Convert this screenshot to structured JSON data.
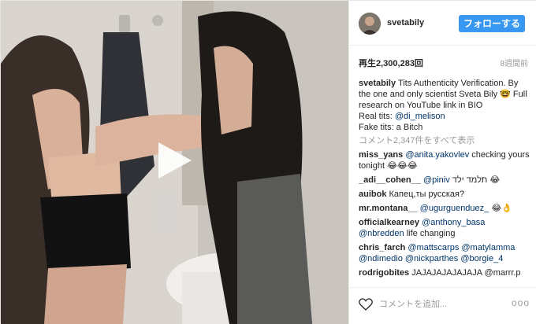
{
  "header": {
    "username": "svetabily",
    "follow_label": "フォローする"
  },
  "stats": {
    "views": "再生2,300,283回",
    "age": "8週間前"
  },
  "caption": {
    "username": "svetabily",
    "text": "Tits Authenticity Verification. By the one and only scientist Sveta Bily 🤓 Full research on YouTube link in BIO",
    "real_label": "Real tits:",
    "real_handle": "@di_melison",
    "fake_line": "Fake tits: a Bitch"
  },
  "view_all": "コメント2,347件をすべて表示",
  "comments": [
    {
      "user": "miss_yans",
      "mention": "@anita.yakovlev",
      "text": "checking yours tonight 😂😂😂"
    },
    {
      "user": "_adi__cohen__",
      "mention": "@piniv",
      "text": "תלמד ילד 😂"
    },
    {
      "user": "auibok",
      "mention": "",
      "text": "Капец,ты русская?"
    },
    {
      "user": "mr.montana__",
      "mention": "@ugurguenduez_",
      "text": "😂👌"
    },
    {
      "user": "officialkearney",
      "mention": "@anthony_basa @nbredden",
      "text": "life changing"
    },
    {
      "user": "chris_farch",
      "mention": "@mattscarps @matylamma @ndimedio @nickparthes @borgie_4",
      "text": ""
    },
    {
      "user": "rodrigobites",
      "mention": "",
      "text": "JAJAJAJAJAJAJA @marrr.p"
    }
  ],
  "footer": {
    "add_comment_placeholder": "コメントを追加...",
    "more": "ooo"
  },
  "icons": {
    "play": "play-icon",
    "heart": "heart-icon",
    "more": "more-options-icon"
  },
  "colors": {
    "accent": "#3897f0",
    "link": "#003569",
    "muted": "#999999"
  }
}
